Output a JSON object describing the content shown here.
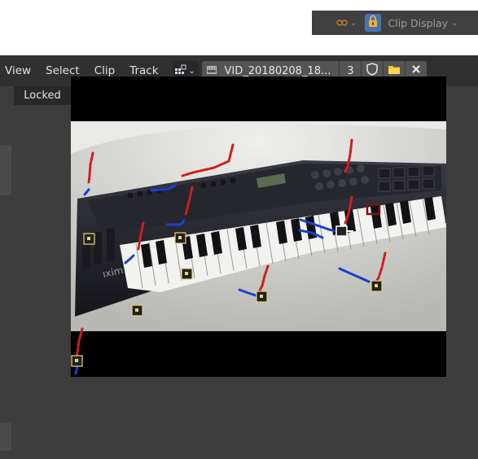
{
  "topbar": {
    "overlay_icon": "overlay-icon",
    "lock_icon": "lock-icon",
    "clip_display_label": "Clip Display",
    "accent": "#4772b3"
  },
  "header": {
    "menus": [
      "View",
      "Select",
      "Clip",
      "Track"
    ],
    "clip_name": "VID_20180208_18...",
    "clip_users": "3",
    "fake_user_icon": "shield-icon",
    "open_icon": "folder-icon",
    "close_icon": "close-icon"
  },
  "status": {
    "locked_label": "Locked"
  },
  "colors": {
    "editor_bg": "#3d3d3d",
    "header_bg": "#303030",
    "path_before": "#cc1e1e",
    "path_after": "#1e3fcc",
    "marker_outline": "#e8d27a"
  }
}
